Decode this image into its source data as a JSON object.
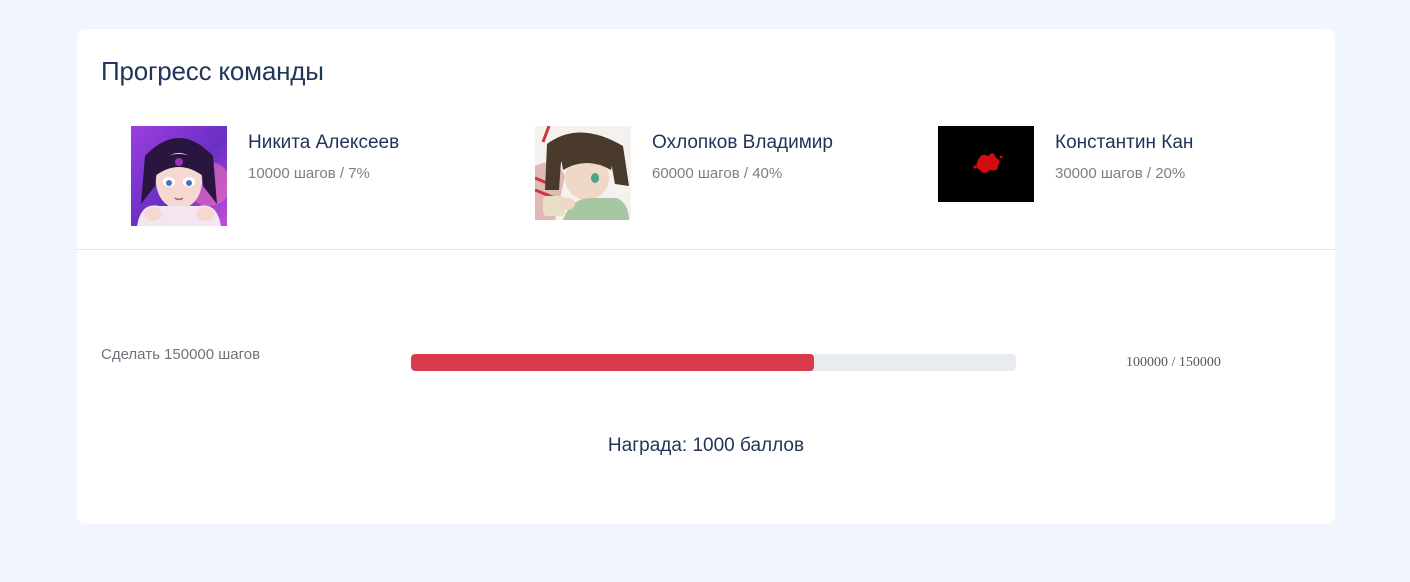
{
  "title": "Прогресс команды",
  "members": [
    {
      "name": "Никита Алексеев",
      "stats": "10000 шагов / 7%",
      "avatar_icon": "anime-girl-avatar"
    },
    {
      "name": "Охлопков Владимир",
      "stats": "60000 шагов / 40%",
      "avatar_icon": "anime-girl-drinking-avatar"
    },
    {
      "name": "Константин Кан",
      "stats": "30000 шагов / 20%",
      "avatar_icon": "red-splash-avatar"
    }
  ],
  "task": {
    "label": "Сделать 150000 шагов",
    "current": 100000,
    "goal": 150000,
    "count_text": "100000 / 150000",
    "progress_color": "#d83a4c",
    "track_color": "#e8ebef"
  },
  "reward": "Награда: 1000 баллов",
  "colors": {
    "background": "#f1f6fe",
    "card": "#ffffff",
    "heading": "#21365a"
  }
}
